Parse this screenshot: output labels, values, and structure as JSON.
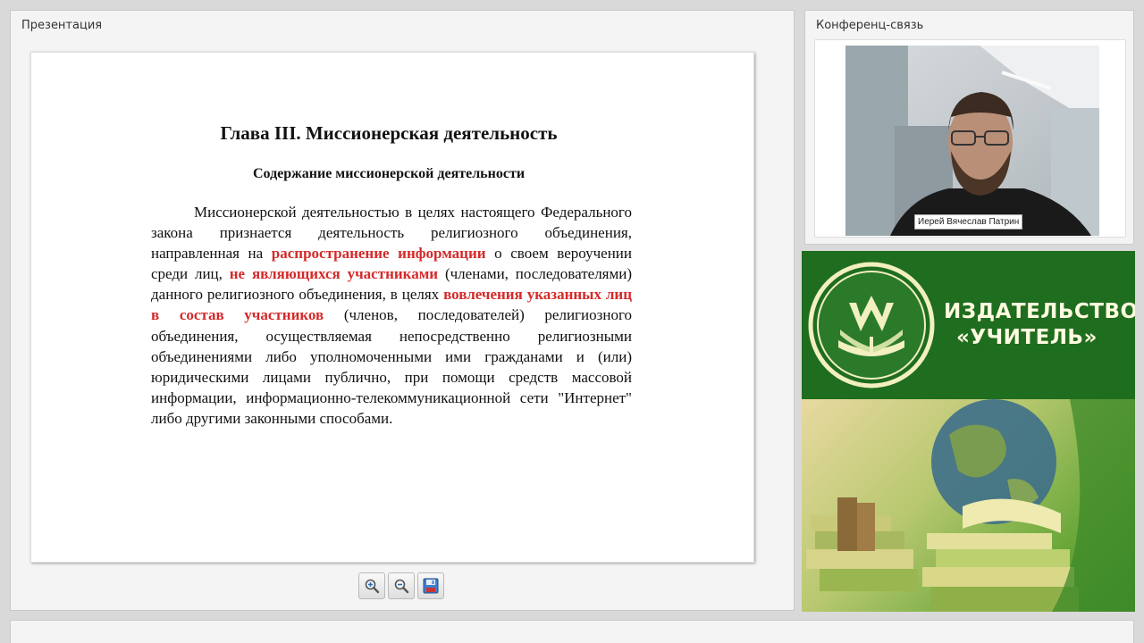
{
  "presentation": {
    "title": "Презентация",
    "slide": {
      "heading": "Глава III. Миссионерская деятельность",
      "subheading": "Содержание миссионерской деятельности",
      "body": {
        "p1": "Миссионерской деятельностью в целях настоящего Федерального закона признается деятельность религиозного объединения, направленная на ",
        "hl1": "распространение информации",
        "p2": " о своем вероучении среди лиц, ",
        "hl2": "не являющихся участниками",
        "p3": " (членами, последователями) данного религиозного объединения, в целях ",
        "hl3": "вовлечения указанных лиц в состав участников",
        "p4": " (членов, последователей) религиозного объединения, осуществляемая непосредственно религиозными объединениями либо уполномоченными ими гражданами и (или) юридическими лицами публично, при помощи средств массовой информации, информационно-телекоммуникационной сети \"Интернет\" либо другими законными способами."
      }
    },
    "toolbar": {
      "zoom_in": "zoom-in-icon",
      "zoom_out": "zoom-out-icon",
      "save": "save-icon"
    }
  },
  "conference": {
    "title": "Конференц-связь",
    "participant_name": "Иерей Вячеслав Патрин"
  },
  "banner": {
    "publisher_line1": "ИЗДАТЕЛЬСТВО",
    "publisher_line2": "«УЧИТЕЛЬ»",
    "colors": {
      "green": "#1f6d1f",
      "text": "#fffbe0"
    }
  },
  "colors": {
    "highlight": "#d42a2a"
  }
}
